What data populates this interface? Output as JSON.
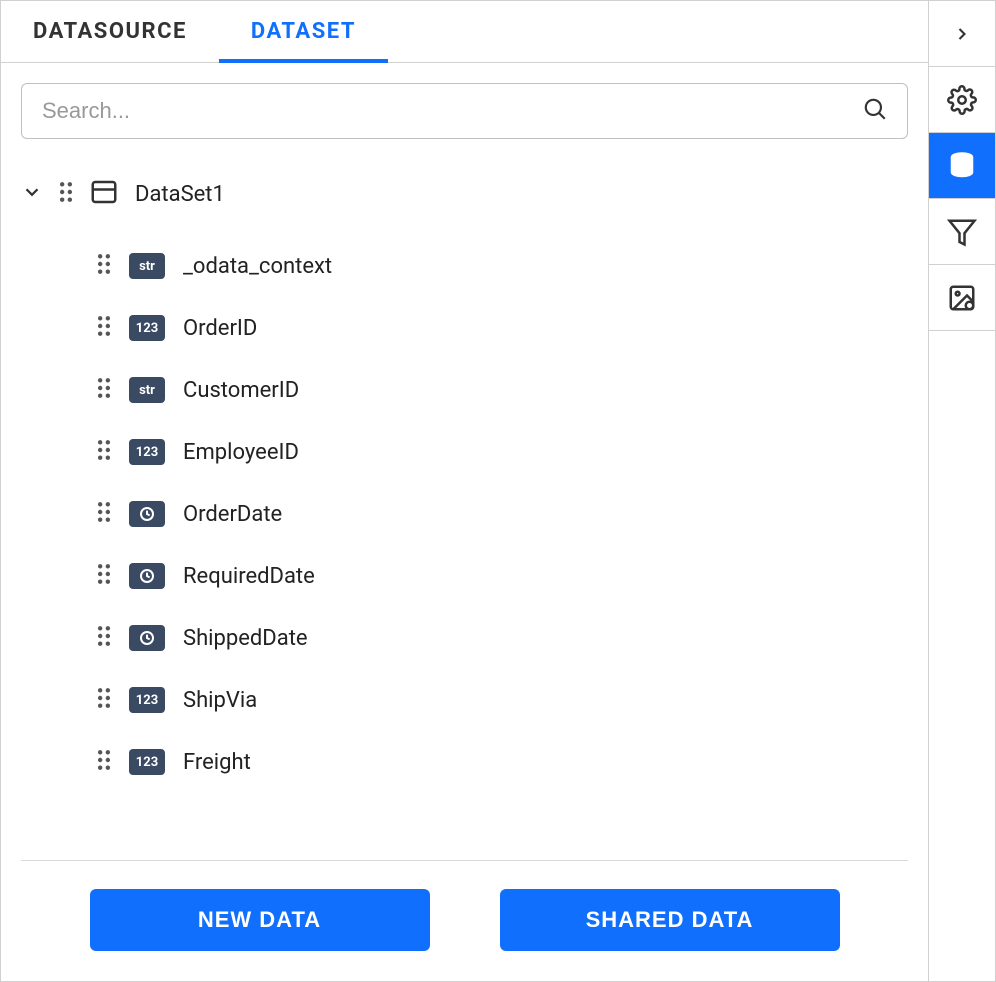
{
  "tabs": {
    "datasource": "DATASOURCE",
    "dataset": "DATASET",
    "active": "dataset"
  },
  "search": {
    "placeholder": "Search...",
    "value": ""
  },
  "dataset": {
    "name": "DataSet1",
    "fields": [
      {
        "type": "str",
        "name": "_odata_context"
      },
      {
        "type": "123",
        "name": "OrderID"
      },
      {
        "type": "str",
        "name": "CustomerID"
      },
      {
        "type": "123",
        "name": "EmployeeID"
      },
      {
        "type": "date",
        "name": "OrderDate"
      },
      {
        "type": "date",
        "name": "RequiredDate"
      },
      {
        "type": "date",
        "name": "ShippedDate"
      },
      {
        "type": "123",
        "name": "ShipVia"
      },
      {
        "type": "123",
        "name": "Freight"
      }
    ]
  },
  "buttons": {
    "new_data": "NEW DATA",
    "shared_data": "SHARED DATA"
  },
  "side_rail": {
    "items": [
      "expand",
      "settings",
      "data",
      "filter",
      "image"
    ],
    "active": "data"
  }
}
